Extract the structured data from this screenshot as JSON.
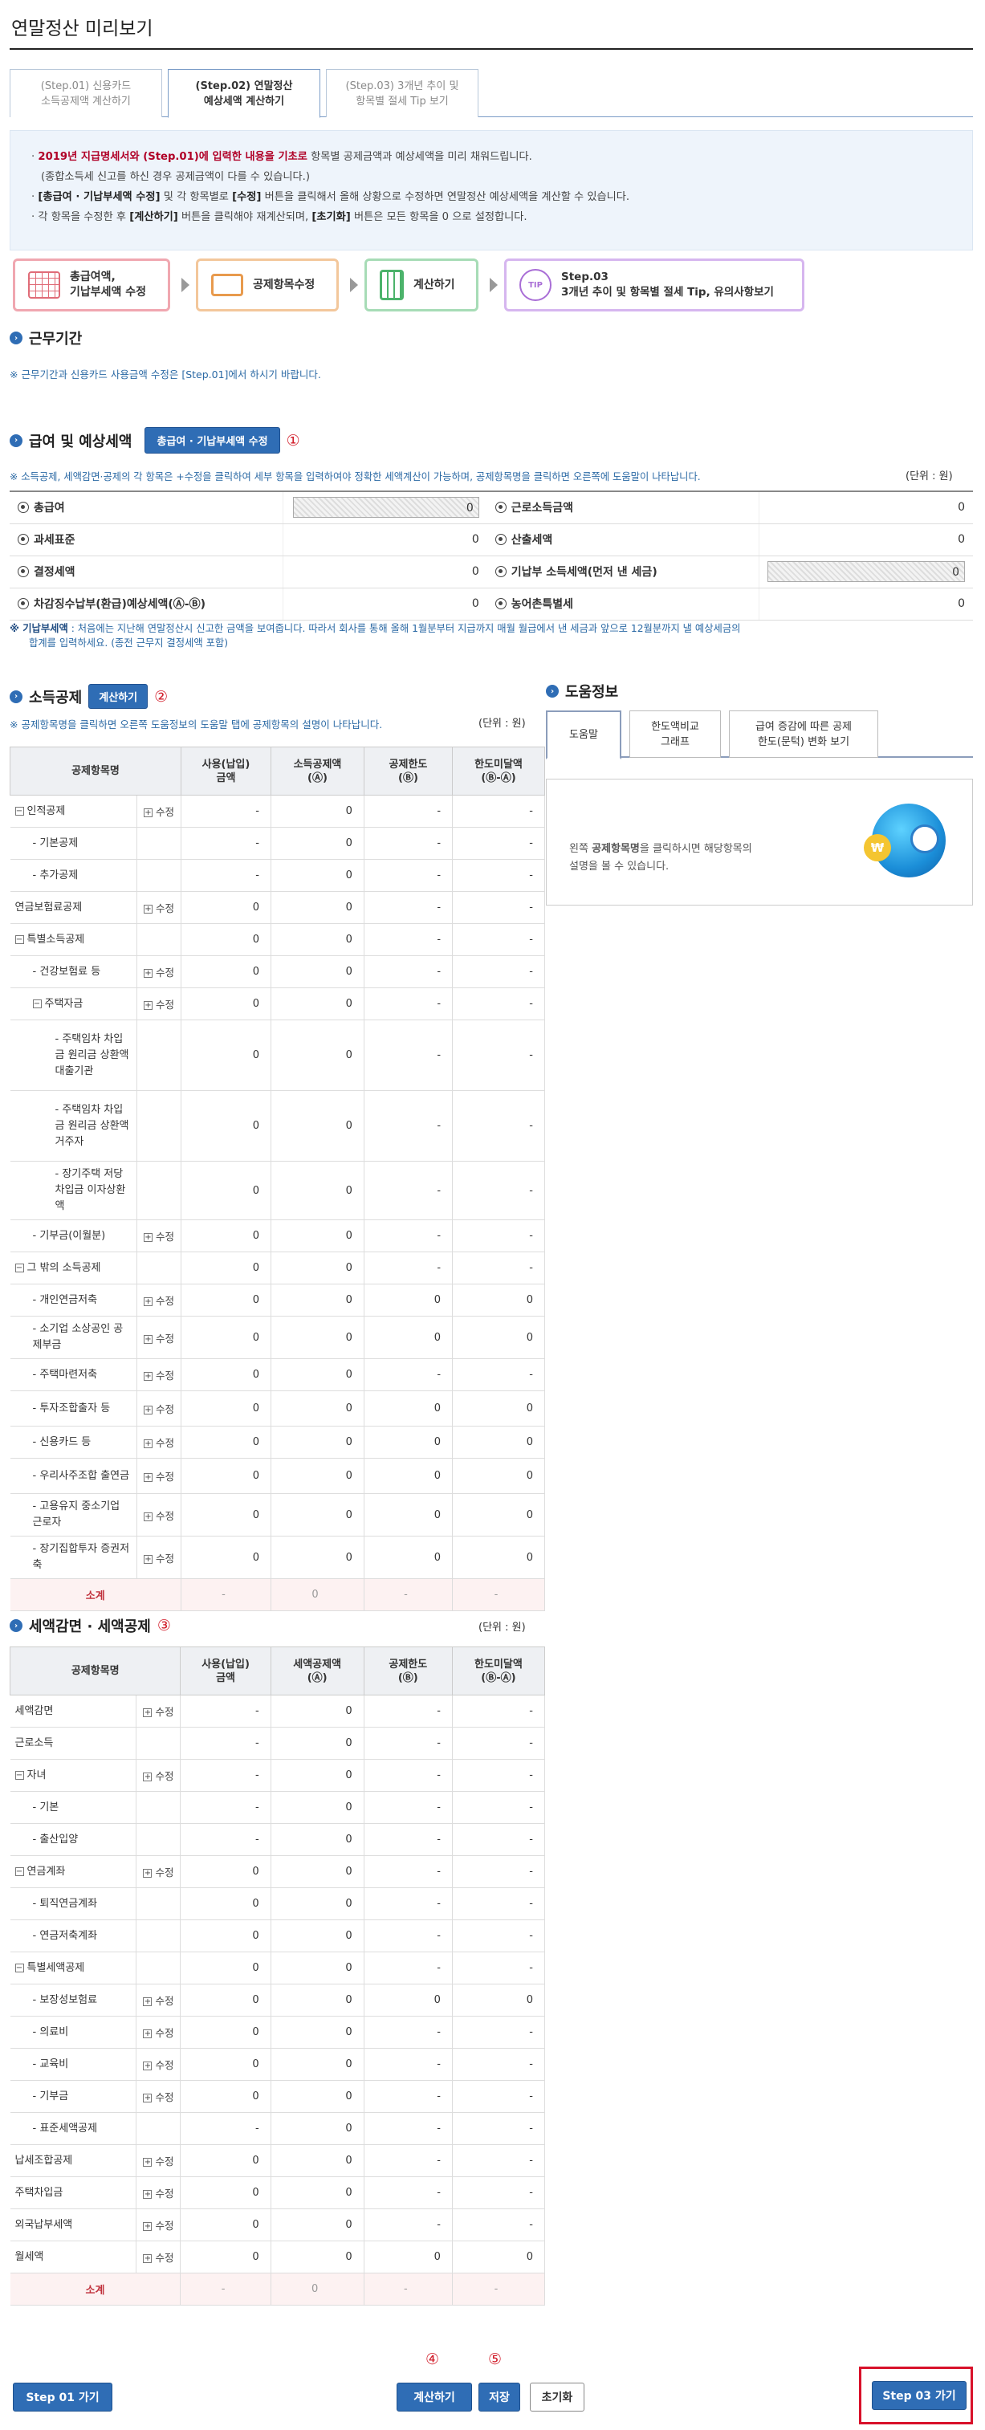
{
  "page_title": "연말정산 미리보기",
  "tabs": [
    {
      "line1": "(Step.01) 신용카드",
      "line2": "소득공제액 계산하기"
    },
    {
      "line1": "(Step.02) 연말정산",
      "line2": "예상세액 계산하기"
    },
    {
      "line1": "(Step.03) 3개년 추이 및",
      "line2": "항목별 절세 Tip 보기"
    }
  ],
  "notice": {
    "l1_red": "2019년 지급명세서와 (Step.01)에 입력한 내용을 기초로",
    "l1_rest": " 항목별 공제금액과 예상세액을 미리 채워드립니다.",
    "l2": "(종합소득세 신고를 하신 경우 공제금액이 다를 수 있습니다.)",
    "l3_b1": "[총급여 · 기납부세액 수정]",
    "l3_m1": " 및 각 항목별로 ",
    "l3_b2": "[수정]",
    "l3_rest": " 버튼을 클릭해서 올해 상황으로 수정하면 연말정산 예상세액을 계산할 수 있습니다.",
    "l4_a": "각 항목을 수정한 후 ",
    "l4_b1": "[계산하기]",
    "l4_m": " 버튼을 클릭해야 재계산되며, ",
    "l4_b2": "[초기화]",
    "l4_rest": " 버튼은 모든 항목을 0 으로 설정합니다."
  },
  "flow": [
    {
      "l1": "총급여액,",
      "l2": "기납부세액 수정",
      "color": "#e06c78"
    },
    {
      "l1": "공제항목수정",
      "l2": "",
      "color": "#e89a4d"
    },
    {
      "l1": "계산하기",
      "l2": "",
      "color": "#4cb36b"
    },
    {
      "l1": "Step.03",
      "l2": "3개년 추이 및 항목별 절세 Tip, 유의사항보기",
      "color": "#a96ed6"
    }
  ],
  "flow_icon_labels": {
    "tip": "TIP"
  },
  "work": {
    "title": "근무기간",
    "note": "※ 근무기간과 신용카드 사용금액 수정은 [Step.01]에서 하시기 바랍니다."
  },
  "salary": {
    "title": "급여 및 예상세액",
    "btn": "총급여 · 기납부세액 수정",
    "mark": "①",
    "note": "※ 소득공제, 세액감면·공제의 각 항목은 +수정을 클릭하여 세부 항목을 입력하여야 정확한 세액계산이 가능하며, 공제항목명을 클릭하면 오른쪽에 도움말이 나타납니다.",
    "unit": "(단위 : 원)",
    "rows": [
      {
        "l": "총급여",
        "lv": "0",
        "r": "근로소득금액",
        "rv": "0"
      },
      {
        "l": "과세표준",
        "lv": "0",
        "r": "산출세액",
        "rv": "0"
      },
      {
        "l": "결정세액",
        "lv": "0",
        "r": "기납부 소득세액(먼저 낸 세금)",
        "rv": "0"
      },
      {
        "l": "차감징수납부(환급)예상세액(Ⓐ-Ⓑ)",
        "lv": "0",
        "r": "농어촌특별세",
        "rv": "0"
      }
    ],
    "foot_b": "※ 기납부세액",
    "foot1": " : 처음에는 지난해 연말정산시 신고한 금액을 보여줍니다. 따라서 회사를 통해 올해 1월분부터 지급까지 매월 월급에서 낸 세금과 앞으로 12월분까지 낼 예상세금의",
    "foot2": "합계를 입력하세요. (종전 근무지 결정세액 포함)"
  },
  "income": {
    "title": "소득공제",
    "btn": "계산하기",
    "mark": "②",
    "note": "※ 공제항목명을 클릭하면 오른쪽 도움정보의 도움말 탭에 공제항목의 설명이 나타납니다.",
    "unit": "(단위 : 원)",
    "headers": [
      "공제항목명",
      "",
      "사용(납입)\n금액",
      "소득공제액\n(Ⓐ)",
      "공제한도\n(Ⓑ)",
      "한도미달액\n(Ⓑ-Ⓐ)"
    ],
    "rows": [
      {
        "n": "인적공제",
        "t": "m",
        "e": "수정",
        "a": "-",
        "b": "0",
        "c": "-",
        "d": "-"
      },
      {
        "n": "- 기본공제",
        "t": "s",
        "e": "",
        "a": "-",
        "b": "0",
        "c": "-",
        "d": "-"
      },
      {
        "n": "- 추가공제",
        "t": "s",
        "e": "",
        "a": "-",
        "b": "0",
        "c": "-",
        "d": "-"
      },
      {
        "n": "연금보험료공제",
        "t": "p",
        "e": "수정",
        "a": "0",
        "b": "0",
        "c": "-",
        "d": "-"
      },
      {
        "n": "특별소득공제",
        "t": "m",
        "e": "",
        "a": "0",
        "b": "0",
        "c": "-",
        "d": "-"
      },
      {
        "n": "- 건강보험료 등",
        "t": "s",
        "e": "수정",
        "a": "0",
        "b": "0",
        "c": "-",
        "d": "-"
      },
      {
        "n": "주택자금",
        "t": "m2",
        "e": "수정",
        "a": "0",
        "b": "0",
        "c": "-",
        "d": "-"
      },
      {
        "n": "- 주택임차 차입금 원리금 상환액 대출기관",
        "t": "ss",
        "e": "",
        "a": "0",
        "b": "0",
        "c": "-",
        "d": "-",
        "h": 88
      },
      {
        "n": "- 주택임차 차입금 원리금 상환액 거주자",
        "t": "ss",
        "e": "",
        "a": "0",
        "b": "0",
        "c": "-",
        "d": "-",
        "h": 88
      },
      {
        "n": "- 장기주택 저당차입금 이자상환액",
        "t": "ss",
        "e": "",
        "a": "0",
        "b": "0",
        "c": "-",
        "d": "-",
        "h": 70
      },
      {
        "n": "- 기부금(이월분)",
        "t": "s",
        "e": "수정",
        "a": "0",
        "b": "0",
        "c": "-",
        "d": "-"
      },
      {
        "n": "그 밖의 소득공제",
        "t": "m",
        "e": "",
        "a": "0",
        "b": "0",
        "c": "-",
        "d": "-"
      },
      {
        "n": "- 개인연금저축",
        "t": "s",
        "e": "수정",
        "a": "0",
        "b": "0",
        "c": "0",
        "d": "0"
      },
      {
        "n": "- 소기업 소상공인 공제부금",
        "t": "s",
        "e": "수정",
        "a": "0",
        "b": "0",
        "c": "0",
        "d": "0",
        "h": 44
      },
      {
        "n": "- 주택마련저축",
        "t": "s",
        "e": "수정",
        "a": "0",
        "b": "0",
        "c": "-",
        "d": "-"
      },
      {
        "n": "- 투자조합출자 등",
        "t": "s",
        "e": "수정",
        "a": "0",
        "b": "0",
        "c": "0",
        "d": "0",
        "h": 44
      },
      {
        "n": "- 신용카드 등",
        "t": "s",
        "e": "수정",
        "a": "0",
        "b": "0",
        "c": "0",
        "d": "0"
      },
      {
        "n": "- 우리사주조합 출연금",
        "t": "s",
        "e": "수정",
        "a": "0",
        "b": "0",
        "c": "0",
        "d": "0",
        "h": 44
      },
      {
        "n": "- 고용유지 중소기업 근로자",
        "t": "s",
        "e": "수정",
        "a": "0",
        "b": "0",
        "c": "0",
        "d": "0",
        "h": 44
      },
      {
        "n": "- 장기집합투자 증권저축",
        "t": "s",
        "e": "수정",
        "a": "0",
        "b": "0",
        "c": "0",
        "d": "0",
        "h": 44
      }
    ],
    "subtotal": {
      "n": "소계",
      "a": "-",
      "b": "0",
      "c": "-",
      "d": "-"
    }
  },
  "help": {
    "title": "도움정보",
    "tabs": [
      {
        "l1": "도움말",
        "l2": ""
      },
      {
        "l1": "한도액비교",
        "l2": "그래프"
      },
      {
        "l1": "급여 증감에 따른 공제",
        "l2": "한도(문턱) 변화 보기"
      }
    ],
    "text1": "왼쪽 ",
    "text_b": "공제항목명",
    "text2": "을 클릭하시면 해당항목의",
    "text3": "설명을 볼 수 있습니다.",
    "won": "₩"
  },
  "tax": {
    "title": "세액감면 · 세액공제",
    "mark": "③",
    "unit": "(단위 : 원)",
    "headers": [
      "공제항목명",
      "",
      "사용(납입)\n금액",
      "세액공제액\n(Ⓐ)",
      "공제한도\n(Ⓑ)",
      "한도미달액\n(Ⓑ-Ⓐ)"
    ],
    "rows": [
      {
        "n": "세액감면",
        "t": "p",
        "e": "수정",
        "a": "-",
        "b": "0",
        "c": "-",
        "d": "-"
      },
      {
        "n": "근로소득",
        "t": "p",
        "e": "",
        "a": "-",
        "b": "0",
        "c": "-",
        "d": "-"
      },
      {
        "n": "자녀",
        "t": "m",
        "e": "수정",
        "a": "-",
        "b": "0",
        "c": "-",
        "d": "-"
      },
      {
        "n": "- 기본",
        "t": "s",
        "e": "",
        "a": "-",
        "b": "0",
        "c": "-",
        "d": "-"
      },
      {
        "n": "- 출산입양",
        "t": "s",
        "e": "",
        "a": "-",
        "b": "0",
        "c": "-",
        "d": "-"
      },
      {
        "n": "연금계좌",
        "t": "m",
        "e": "수정",
        "a": "0",
        "b": "0",
        "c": "-",
        "d": "-"
      },
      {
        "n": "- 퇴직연금계좌",
        "t": "s",
        "e": "",
        "a": "0",
        "b": "0",
        "c": "-",
        "d": "-"
      },
      {
        "n": "- 연금저축계좌",
        "t": "s",
        "e": "",
        "a": "0",
        "b": "0",
        "c": "-",
        "d": "-"
      },
      {
        "n": "특별세액공제",
        "t": "m",
        "e": "",
        "a": "0",
        "b": "0",
        "c": "-",
        "d": "-"
      },
      {
        "n": "- 보장성보험료",
        "t": "s",
        "e": "수정",
        "a": "0",
        "b": "0",
        "c": "0",
        "d": "0"
      },
      {
        "n": "- 의료비",
        "t": "s",
        "e": "수정",
        "a": "0",
        "b": "0",
        "c": "-",
        "d": "-"
      },
      {
        "n": "- 교육비",
        "t": "s",
        "e": "수정",
        "a": "0",
        "b": "0",
        "c": "-",
        "d": "-"
      },
      {
        "n": "- 기부금",
        "t": "s",
        "e": "수정",
        "a": "0",
        "b": "0",
        "c": "-",
        "d": "-"
      },
      {
        "n": "- 표준세액공제",
        "t": "s",
        "e": "",
        "a": "-",
        "b": "0",
        "c": "-",
        "d": "-"
      },
      {
        "n": "납세조합공제",
        "t": "p",
        "e": "수정",
        "a": "0",
        "b": "0",
        "c": "-",
        "d": "-"
      },
      {
        "n": "주택차입금",
        "t": "p",
        "e": "수정",
        "a": "0",
        "b": "0",
        "c": "-",
        "d": "-"
      },
      {
        "n": "외국납부세액",
        "t": "p",
        "e": "수정",
        "a": "0",
        "b": "0",
        "c": "-",
        "d": "-"
      },
      {
        "n": "월세액",
        "t": "p",
        "e": "수정",
        "a": "0",
        "b": "0",
        "c": "0",
        "d": "0"
      }
    ],
    "subtotal": {
      "n": "소계",
      "a": "-",
      "b": "0",
      "c": "-",
      "d": "-"
    }
  },
  "footer": {
    "step01": "Step 01 가기",
    "calc": "계산하기",
    "save": "저장",
    "reset": "초기화",
    "step03": "Step 03 가기",
    "mark4": "④",
    "mark5": "⑤"
  },
  "colors": {
    "accent": "#2f6db5",
    "highlight_border": "#d8112a"
  }
}
